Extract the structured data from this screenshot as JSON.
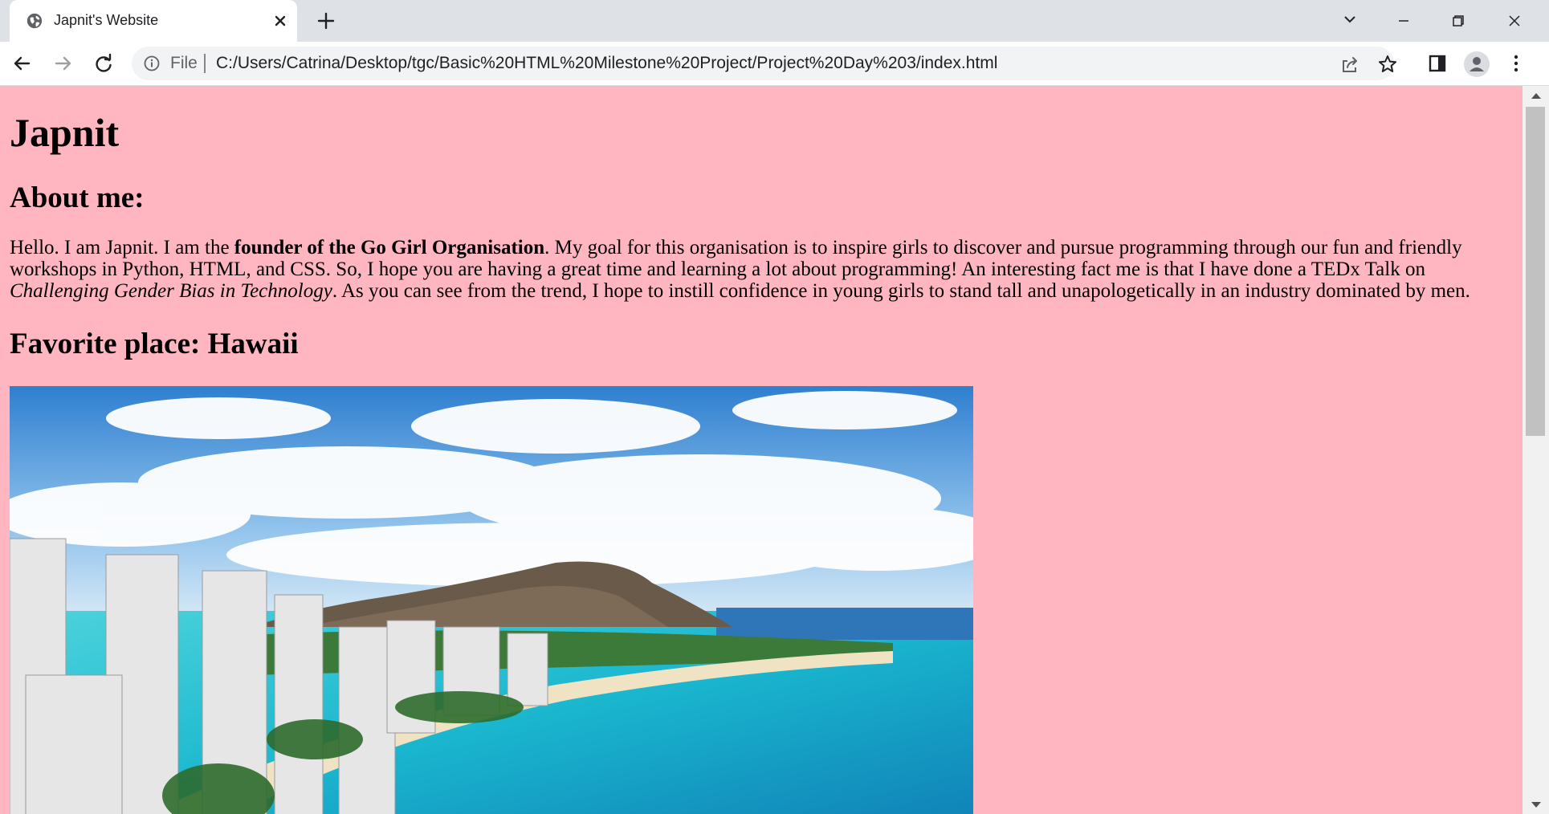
{
  "browser": {
    "tab": {
      "title": "Japnit's Website",
      "favicon": "globe-icon"
    },
    "new_tab_icon": "plus-icon",
    "address_bar": {
      "chip": "File",
      "url": "C:/Users/Catrina/Desktop/tgc/Basic%20HTML%20Milestone%20Project/Project%20Day%203/index.html"
    }
  },
  "page": {
    "background_color": "#ffb6c1",
    "title": "Japnit",
    "about_heading": "About me:",
    "bio": {
      "t1": "Hello. I am Japnit. I am the ",
      "b1": "founder of the Go Girl Organisation",
      "t2": ". My goal for this organisation is to inspire girls to discover and pursue programming through our fun and friendly workshops in Python, HTML, and CSS. So, I hope you are having a great time and learning a lot about programming! An interesting fact me is that I have done a TEDx Talk on ",
      "i1": "Challenging Gender Bias in Technology",
      "t3": ". As you can see from the trend, I hope to instill confidence in young girls to stand tall and unapologetically in an industry dominated by men."
    },
    "favorite_heading": "Favorite place: Hawaii",
    "image": "waikiki-diamond-head-photo"
  }
}
